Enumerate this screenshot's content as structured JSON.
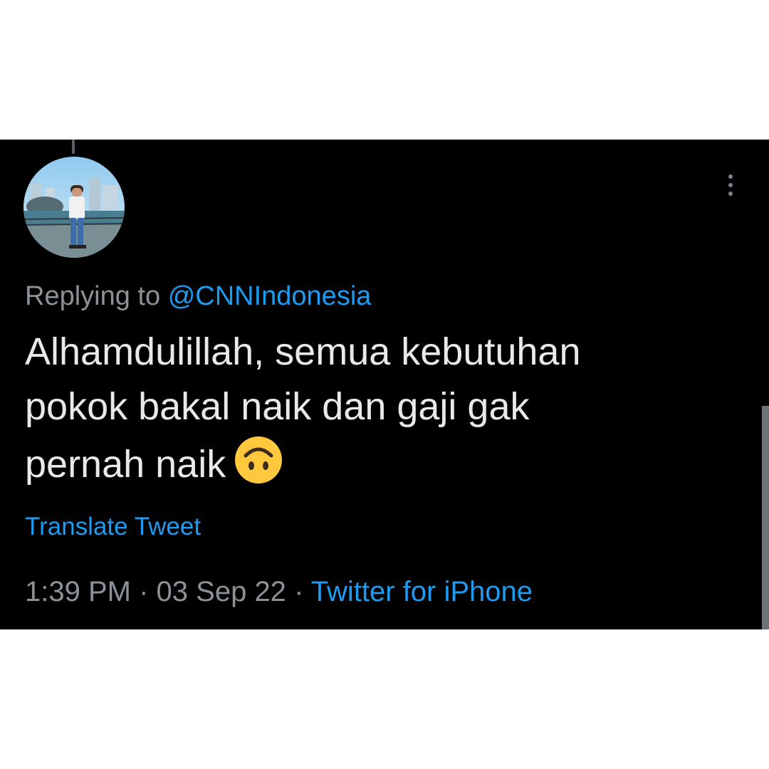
{
  "tweet": {
    "replying_prefix": "Replying to",
    "replying_handle": "@CNNIndonesia",
    "text_lines": [
      "Alhamdulillah, semua kebutuhan",
      "pokok bakal naik dan gaji gak",
      "pernah naik"
    ],
    "emoji": "upside-down-face-icon",
    "translate_label": "Translate Tweet",
    "time": "1:39 PM",
    "date": "03 Sep 22",
    "separator": "·",
    "source": "Twitter for iPhone"
  },
  "icons": {
    "avatar": "avatar-photo",
    "more": "more-dots-icon"
  },
  "colors": {
    "background": "#000000",
    "text": "#e7e9ea",
    "secondary_text": "#8b9298",
    "accent": "#1d9bf0",
    "emoji": "#ffc83d"
  }
}
